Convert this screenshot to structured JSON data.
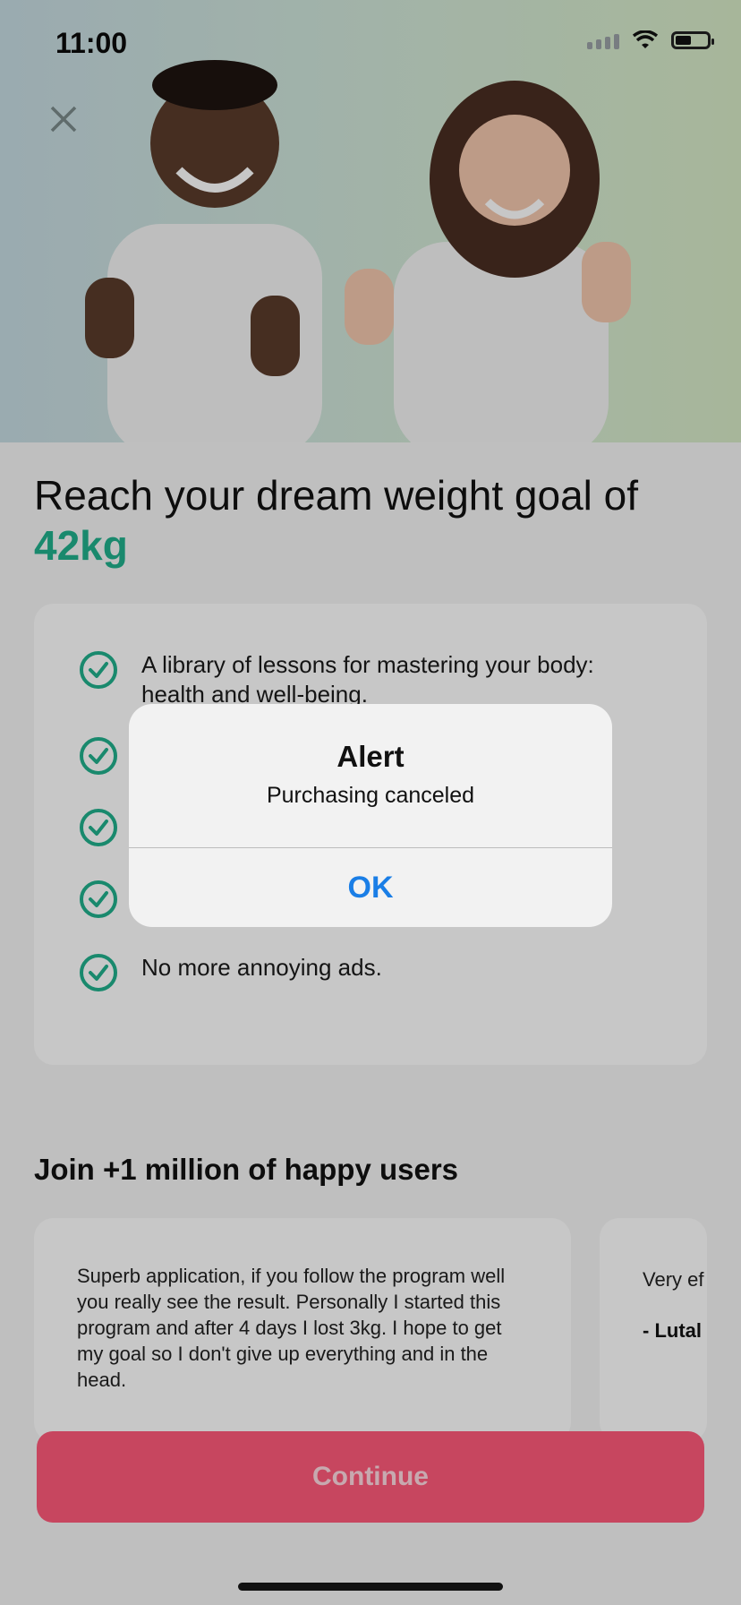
{
  "status": {
    "time": "11:00"
  },
  "headline": {
    "text": "Reach your dream weight goal of",
    "goal": "42kg"
  },
  "features": [
    {
      "text": "A library of lessons for mastering your body: health and well-being."
    },
    {
      "text": ""
    },
    {
      "text": ""
    },
    {
      "text": ""
    },
    {
      "text": "No more annoying ads."
    }
  ],
  "social": {
    "title": "Join +1 million of happy users"
  },
  "reviews": [
    {
      "text": "Superb application, if you follow the program well you really see the result. Personally I started this program and after 4 days I lost 3kg. I hope to get my goal so I don't give up everything and in the head.",
      "author": ""
    },
    {
      "text": "Very ef clear a am ver",
      "author": "- Lutal"
    }
  ],
  "cta": {
    "label": "Continue"
  },
  "alert": {
    "title": "Alert",
    "message": "Purchasing canceled",
    "ok_label": "OK"
  },
  "colors": {
    "accent": "#21b08c",
    "cta": "#ff5a7a",
    "link": "#1a7ee6"
  },
  "icons": {
    "close": "close-icon",
    "check": "check-circle-icon",
    "wifi": "wifi-icon",
    "battery": "battery-icon"
  }
}
